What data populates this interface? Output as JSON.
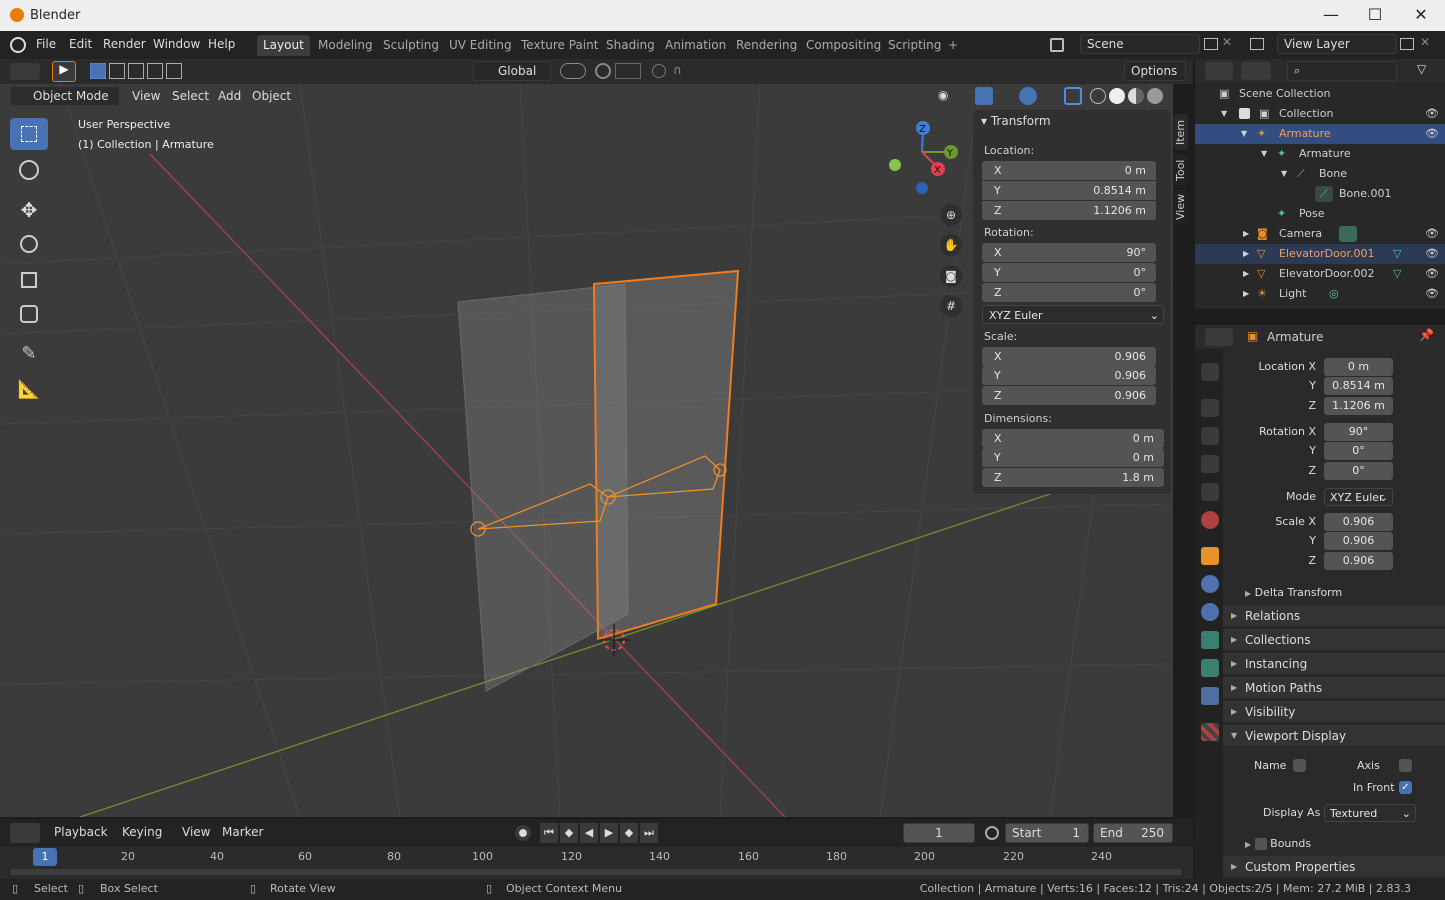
{
  "app": {
    "title": "Blender",
    "min": "—",
    "max": "☐",
    "close": "✕"
  },
  "menu": [
    "File",
    "Edit",
    "Render",
    "Window",
    "Help"
  ],
  "workspaces": [
    "Layout",
    "Modeling",
    "Sculpting",
    "UV Editing",
    "Texture Paint",
    "Shading",
    "Animation",
    "Rendering",
    "Compositing",
    "Scripting",
    "+"
  ],
  "scene": {
    "name": "Scene",
    "view_layer": "View Layer"
  },
  "toolheader": {
    "orientation": "Global",
    "options": "Options"
  },
  "viewport_header": {
    "mode": "Object Mode",
    "menus": [
      "View",
      "Select",
      "Add",
      "Object"
    ]
  },
  "viewport": {
    "perspective": "User Perspective",
    "context": "(1) Collection | Armature"
  },
  "gizmo": {
    "x": "X",
    "y": "Y",
    "z": "Z"
  },
  "npanel": {
    "title": "Transform",
    "location_label": "Location:",
    "location": [
      {
        "axis": "X",
        "value": "0 m"
      },
      {
        "axis": "Y",
        "value": "0.8514 m"
      },
      {
        "axis": "Z",
        "value": "1.1206 m"
      }
    ],
    "rotation_label": "Rotation:",
    "rotation": [
      {
        "axis": "X",
        "value": "90°"
      },
      {
        "axis": "Y",
        "value": "0°"
      },
      {
        "axis": "Z",
        "value": "0°"
      }
    ],
    "rotation_mode": "XYZ Euler",
    "scale_label": "Scale:",
    "scale": [
      {
        "axis": "X",
        "value": "0.906"
      },
      {
        "axis": "Y",
        "value": "0.906"
      },
      {
        "axis": "Z",
        "value": "0.906"
      }
    ],
    "dimensions_label": "Dimensions:",
    "dimensions": [
      {
        "axis": "X",
        "value": "0 m"
      },
      {
        "axis": "Y",
        "value": "0 m"
      },
      {
        "axis": "Z",
        "value": "1.8 m"
      }
    ],
    "tabs": [
      "Item",
      "Tool",
      "View"
    ]
  },
  "timeline": {
    "menus": [
      "Playback",
      "Keying",
      "View",
      "Marker"
    ],
    "current_frame": "1",
    "start_label": "Start",
    "start": "1",
    "end_label": "End",
    "end": "250",
    "ticks": [
      "1",
      "20",
      "40",
      "60",
      "80",
      "100",
      "120",
      "140",
      "160",
      "180",
      "200",
      "220",
      "240"
    ]
  },
  "status": {
    "select": "Select",
    "box_select": "Box Select",
    "rotate_view": "Rotate View",
    "context_menu": "Object Context Menu",
    "info": "Collection | Armature | Verts:16 | Faces:12 | Tris:24 | Objects:2/5 | Mem: 27.2 MiB | 2.83.3"
  },
  "outliner": {
    "items": [
      {
        "label": "Scene Collection",
        "color": "#d0d0d0"
      },
      {
        "label": "Collection",
        "color": "#d0d0d0"
      },
      {
        "label": "Armature",
        "color": "#f0a055"
      },
      {
        "label": "Armature",
        "color": "#d0d0d0"
      },
      {
        "label": "Bone",
        "color": "#d0d0d0"
      },
      {
        "label": "Bone.001",
        "color": "#d0d0d0"
      },
      {
        "label": "Pose",
        "color": "#d0d0d0"
      },
      {
        "label": "Camera",
        "color": "#d0d0d0"
      },
      {
        "label": "ElevatorDoor.001",
        "color": "#f0a055"
      },
      {
        "label": "ElevatorDoor.002",
        "color": "#d0d0d0"
      },
      {
        "label": "Light",
        "color": "#d0d0d0"
      }
    ]
  },
  "properties": {
    "object_name": "Armature",
    "location_x_label": "Location X",
    "y_label": "Y",
    "z_label": "Z",
    "location": [
      "0 m",
      "0.8514 m",
      "1.1206 m"
    ],
    "rotation_x_label": "Rotation X",
    "rotation": [
      "90°",
      "0°",
      "0°"
    ],
    "mode_label": "Mode",
    "mode": "XYZ Euler",
    "scale_x_label": "Scale X",
    "scale": [
      "0.906",
      "0.906",
      "0.906"
    ],
    "delta": "Delta Transform",
    "panels": [
      "Relations",
      "Collections",
      "Instancing",
      "Motion Paths",
      "Visibility"
    ],
    "viewport_display": "Viewport Display",
    "name_label": "Name",
    "axis_label": "Axis",
    "in_front_label": "In Front",
    "display_as_label": "Display As",
    "display_as": "Textured",
    "bounds_label": "Bounds",
    "custom_props": "Custom Properties"
  }
}
